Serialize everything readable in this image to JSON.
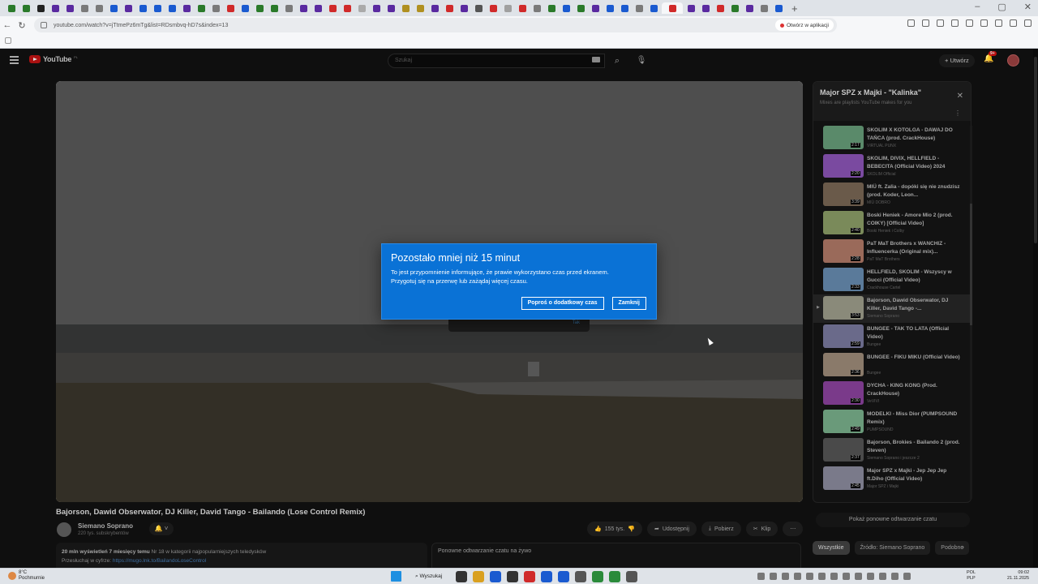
{
  "browser": {
    "url": "youtube.com/watch?v=jTtmePz6mTg&list=RDsmbvq-hD7s&index=13",
    "open_in_app": "Otwórz w aplikacji",
    "new_tab": "+",
    "tab_colors": [
      "#2a7a2a",
      "#2a7a2a",
      "#222",
      "#5a2aa0",
      "#5a2aa0",
      "#7a7a7a",
      "#7a7a7a",
      "#1a5ad0",
      "#5a2aa0",
      "#1a5ad0",
      "#1a5ad0",
      "#1a5ad0",
      "#5a2aa0",
      "#2a7a2a",
      "#7a7a7a",
      "#d02a2a",
      "#1a5ad0",
      "#2a7a2a",
      "#2a7a2a",
      "#7a7a7a",
      "#5a2aa0",
      "#5a2aa0",
      "#d02a2a",
      "#d02a2a",
      "#aaa",
      "#5a2aa0",
      "#5a2aa0",
      "#b09020",
      "#b09020",
      "#5a2aa0",
      "#d02a2a",
      "#5a2aa0",
      "#555",
      "#d02a2a",
      "#a0a0a0",
      "#d02a2a",
      "#7a7a7a",
      "#2a7a2a",
      "#1a5ad0",
      "#2a7a2a",
      "#5a2aa0",
      "#1a5ad0",
      "#1a5ad0",
      "#7a7a7a",
      "#1a5ad0",
      "#d02a2a",
      "#5a2aa0",
      "#5a2aa0",
      "#d02a2a",
      "#2a7a2a",
      "#5a2aa0",
      "#7a7a7a",
      "#1a5ad0"
    ]
  },
  "youtube": {
    "logo": "YouTube",
    "logo_country": "PL",
    "search_placeholder": "Szukaj",
    "create_label": "Utwórz",
    "notif_count": "9+"
  },
  "video": {
    "title": "Bajorson, Dawid Obserwator, DJ Killer, David Tango - Bailando (Lose Control Remix)",
    "channel": "Siemano Soprano",
    "subscribers": "220 tys. subskrybentów",
    "likes": "155 tys.",
    "share": "Udostępnij",
    "download": "Pobierz",
    "clip": "Klip",
    "views_line": "20 mln wyświetleń  7 miesięcy temu",
    "trending": "Nr 18 w kategorii najpopularniejszych teledysków",
    "listen_label": "Przesłuchaj w cyfrze:",
    "listen_link": "https://mugo.lnk.to/BailandoLoseControl",
    "chat_replay": "Ponowne odtwarzanie czatu na żywo"
  },
  "dialog": {
    "title": "Pozostało mniej niż 15 minut",
    "line1": "To jest przypomnienie informujące, że prawie wykorzystano czas przed ekranem.",
    "line2": "Przygotuj się na przerwę lub zażądaj więcej czasu.",
    "btn_more": "Poproś o dodatkowy czas",
    "btn_close": "Zamknij",
    "under_text": "Tak"
  },
  "playlist": {
    "title": "Major SPZ x Majki - \"Kalinka\"",
    "subtitle": "Mixes are playlists YouTube makes for you",
    "items": [
      {
        "title": "SKOLIM X KOTOLGA - DAWAJ DO TAŃCA (prod. CrackHouse)",
        "channel": "VIRTUAL PUNX",
        "duration": "2:17",
        "color": "#5a8a6a",
        "current": false
      },
      {
        "title": "SKOLIM, DIVIX, HELLFIELD - BEBECITA (Official Video) 2024",
        "channel": "SKOLIM Official",
        "duration": "2:20",
        "color": "#7a4aa0",
        "current": false
      },
      {
        "title": "MIÜ ft. Zalia - dopóki się nie znudzisz (prod. Koder, Leon...",
        "channel": "MIÜ DOBRO",
        "duration": "3:39",
        "color": "#6a5a4a",
        "current": false
      },
      {
        "title": "Boski Heniek - Amore Mio 2 (prod. COIKY) [Official Video]",
        "channel": "Boski Heniek i Colby",
        "duration": "2:40",
        "color": "#7a8a5a",
        "current": false
      },
      {
        "title": "PaT MaT Brothers x WANCHIZ - Influencerka (Original mix)...",
        "channel": "PaT MaT Brothers",
        "duration": "2:28",
        "color": "#9a6a5a",
        "current": false
      },
      {
        "title": "HELLFIELD, SKOLIM - Wszyscy w Gucci (Official Video)",
        "channel": "Crackhouse Cartel",
        "duration": "2:33",
        "color": "#5a7a9a",
        "current": false
      },
      {
        "title": "Bajorson, Dawid Obserwator, DJ Killer, David Tango -...",
        "channel": "Siemano Soprano",
        "duration": "3:53",
        "color": "#8a8a7a",
        "current": true
      },
      {
        "title": "BUNGEE - TAK TO LATA (Official Video)",
        "channel": "Bungee",
        "duration": "2:59",
        "color": "#6a6a8a",
        "current": false
      },
      {
        "title": "BUNGEE - FIKU MIKU (Official Video)",
        "channel": "Bungee",
        "duration": "2:36",
        "color": "#8a7a6a",
        "current": false
      },
      {
        "title": "DYCHA - KING KONG (Prod. CrackHouse)",
        "channel": "VeVIVI",
        "duration": "2:30",
        "color": "#7a3a8a",
        "current": false
      },
      {
        "title": "MODELKI - Miss Dior (PUMPSOUND Remix)",
        "channel": "PUMPSOUND",
        "duration": "2:49",
        "color": "#6a9a7a",
        "current": false
      },
      {
        "title": "Bajorson, Brokies - Bailando 2 (prod. Steven)",
        "channel": "Siemano Soprano i jeszcze 2",
        "duration": "2:37",
        "color": "#4a4a4a",
        "current": false
      },
      {
        "title": "Major SPZ x Majki - Jep Jep Jep ft.Diho (Official Video)",
        "channel": "Major SPZ i Majki",
        "duration": "2:45",
        "color": "#7a7a8a",
        "current": false
      }
    ],
    "show_chat": "Pokaż ponowne odtwarzanie czatu",
    "chips": [
      "Wszystkie",
      "Źródło: Siemano Soprano",
      "Podobne"
    ]
  },
  "taskbar": {
    "temp": "8°C",
    "weather": "Pochmurnie",
    "search": "Wyszukaj",
    "lang1": "POL",
    "lang2": "PLP",
    "time": "09:02",
    "date": "21.11.2025",
    "app_colors": [
      "#333",
      "#d9a020",
      "#1a5ad0",
      "#333",
      "#d02a2a",
      "#1a5ad0",
      "#1a5ad0",
      "#555",
      "#2a8a3a",
      "#2a8a3a",
      "#555"
    ]
  }
}
